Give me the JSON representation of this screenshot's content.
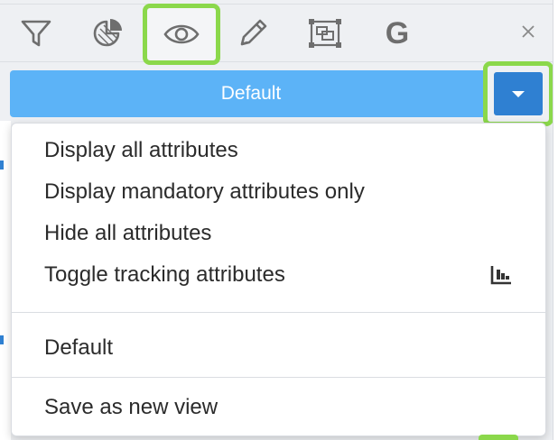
{
  "toolbar": {
    "tools": [
      {
        "icon": "filter-icon",
        "active": false
      },
      {
        "icon": "pie-chart-icon",
        "active": false
      },
      {
        "icon": "eye-icon",
        "active": true
      },
      {
        "icon": "pencil-icon",
        "active": false
      },
      {
        "icon": "select-region-icon",
        "active": false
      },
      {
        "icon": "google-icon",
        "label": "G",
        "active": false
      }
    ],
    "close_icon": "close-icon"
  },
  "view_selector": {
    "current": "Default",
    "toggle_icon": "caret-down-icon"
  },
  "menu": {
    "attribute_options": [
      "Display all attributes",
      "Display mandatory attributes only",
      "Hide all attributes",
      "Toggle tracking attributes"
    ],
    "tracking_icon": "bar-chart-icon",
    "views": [
      "Default"
    ],
    "save_label": "Save as new view"
  },
  "colors": {
    "highlight": "#8bd84b",
    "primary": "#5cb3f7",
    "primary_dark": "#2f80d2",
    "icon": "#6e6e6e"
  }
}
